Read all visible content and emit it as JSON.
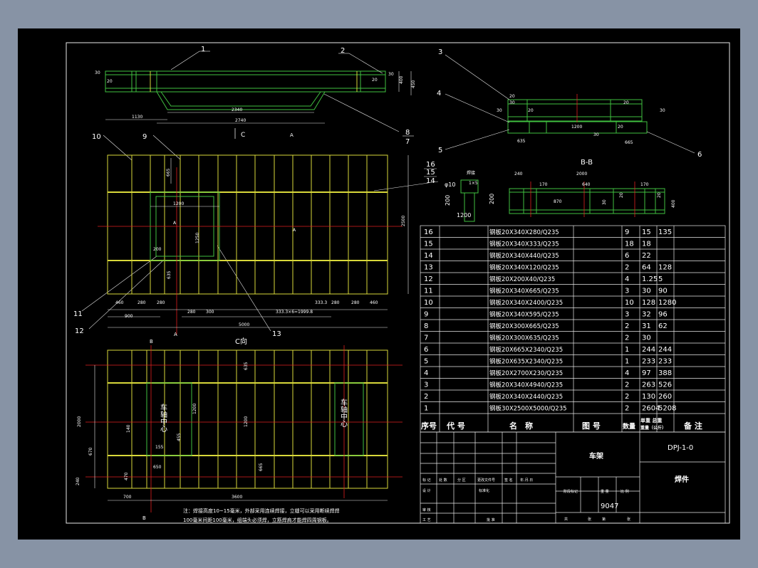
{
  "colors": {
    "background": "#8793a5",
    "sheet": "#000000",
    "outline": "#e8e8e8",
    "member": "#d8d83a",
    "part": "#40c040",
    "centerline": "#e02020",
    "annotation": "#ffffff"
  },
  "callouts": [
    "1",
    "2",
    "3",
    "4",
    "5",
    "6",
    "7",
    "8",
    "9",
    "10",
    "11",
    "12",
    "13",
    "14",
    "15",
    "16"
  ],
  "views": {
    "section_bb": "B-B",
    "view_c": "C向",
    "marker_c": "C",
    "marker_a": "A",
    "marker_b": "B",
    "car_center": "车轴中心"
  },
  "detail": {
    "dims": [
      "1200",
      "200",
      "200",
      "φ10"
    ],
    "note_weld": "焊接",
    "note_size": "1×5"
  },
  "dimensions": {
    "top_view": [
      "30",
      "20",
      "20",
      "30",
      "400",
      "450",
      "1130",
      "2340",
      "2740"
    ],
    "sections": [
      "30",
      "20",
      "30",
      "20",
      "1200",
      "20",
      "30",
      "30",
      "20",
      "635",
      "665"
    ],
    "bb": [
      "240",
      "2000",
      "170",
      "640",
      "170",
      "870",
      "30",
      "20",
      "20",
      "400"
    ],
    "plan": [
      "665",
      "1200",
      "1250",
      "200",
      "635",
      "2500",
      "460",
      "280",
      "280",
      "280",
      "300",
      "5000",
      "900",
      "333.3×6=1999.8",
      "333.3",
      "280",
      "280",
      "460"
    ],
    "view_c": [
      "635",
      "1200",
      "1200",
      "665",
      "140",
      "155",
      "455",
      "650",
      "2000",
      "670",
      "470",
      "240",
      "700",
      "3600"
    ]
  },
  "note": [
    "注：焊接高度10~15毫米，外部采用连续焊接，立缝可以采用断续焊焊",
    "100毫米间距100毫米，组端头必须焊，立筋焊肩才能焊四周钢板。"
  ],
  "bom": {
    "headers": {
      "item": "序号",
      "code": "代 号",
      "name": "名　称",
      "drawing": "图 号",
      "qty": "数量",
      "weight_label_top": "单重 总重",
      "weight_label_bottom": "重量（公斤）",
      "remark": "备 注"
    },
    "rows": [
      {
        "no": "16",
        "name": "钢板20X340X280/Q235",
        "qty": "9",
        "unit": "15",
        "total": "135"
      },
      {
        "no": "15",
        "name": "钢板20X340X333/Q235",
        "qty": "18",
        "unit": "18",
        "total": ""
      },
      {
        "no": "14",
        "name": "钢板20X340X440/Q235",
        "qty": "6",
        "unit": "22",
        "total": ""
      },
      {
        "no": "13",
        "name": "钢板20X340X120/Q235",
        "qty": "2",
        "unit": "64",
        "total": "128"
      },
      {
        "no": "12",
        "name": "钢板20X200X40/Q235",
        "qty": "4",
        "unit": "1.25",
        "total": "5"
      },
      {
        "no": "11",
        "name": "钢板20X340X665/Q235",
        "qty": "3",
        "unit": "30",
        "total": "90"
      },
      {
        "no": "10",
        "name": "钢板20X340X2400/Q235",
        "qty": "10",
        "unit": "128",
        "total": "1280"
      },
      {
        "no": "9",
        "name": "钢板20X340X595/Q235",
        "qty": "3",
        "unit": "32",
        "total": "96"
      },
      {
        "no": "8",
        "name": "钢板20X300X665/Q235",
        "qty": "2",
        "unit": "31",
        "total": "62"
      },
      {
        "no": "7",
        "name": "钢板20X300X635/Q235",
        "qty": "2",
        "unit": "30",
        "total": ""
      },
      {
        "no": "6",
        "name": "钢板20X665X2340/Q235",
        "qty": "1",
        "unit": "244",
        "total": "244"
      },
      {
        "no": "5",
        "name": "钢板20X635X2340/Q235",
        "qty": "1",
        "unit": "233",
        "total": "233"
      },
      {
        "no": "4",
        "name": "钢板20X2700X230/Q235",
        "qty": "4",
        "unit": "97",
        "total": "388"
      },
      {
        "no": "3",
        "name": "钢板20X340X4940/Q235",
        "qty": "2",
        "unit": "263",
        "total": "526"
      },
      {
        "no": "2",
        "name": "钢板20X340X2440/Q235",
        "qty": "2",
        "unit": "130",
        "total": "260"
      },
      {
        "no": "1",
        "name": "钢板30X2500X5000/Q235",
        "qty": "2",
        "unit": "2604",
        "total": "5208"
      }
    ]
  },
  "title_block": {
    "part_name": "车架",
    "drawing_no": "DPJ-1-0",
    "remark": "焊件",
    "weight": "9047",
    "rev_labels": [
      "标 记",
      "处 数",
      "分 区",
      "更改文件号",
      "签 名",
      "年.月.日"
    ],
    "design": "设 计",
    "standardize": "标准化",
    "stage": "阶段标记",
    "weight_label": "重 量",
    "scale_label": "比 例",
    "review": "审 核",
    "process": "工 艺",
    "approve": "批 准",
    "sheet_info": [
      "共",
      "张",
      "第",
      "张"
    ]
  }
}
